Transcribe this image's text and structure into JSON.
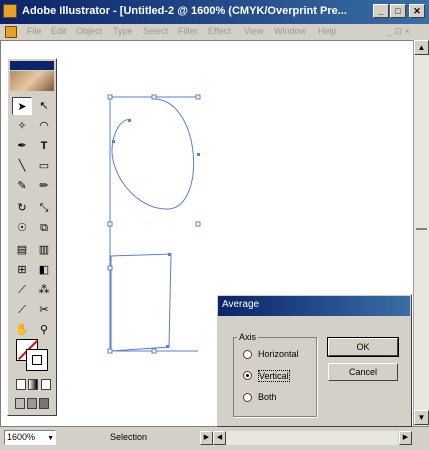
{
  "window": {
    "title": "Adobe Illustrator - [Untitled-2 @ 1600% (CMYK/Overprint Pre...",
    "minimize": "_",
    "maximize": "□",
    "close": "✕"
  },
  "menubar": {
    "items": [
      "File",
      "Edit",
      "Object",
      "Type",
      "Select",
      "Filter",
      "Effect",
      "View",
      "Window",
      "Help"
    ],
    "right": "_ ⊡ ×"
  },
  "statusbar": {
    "zoom": "1600%",
    "status": "Selection"
  },
  "toolbox": {
    "tools": [
      "selection-arrow",
      "direct-selection",
      "magic-wand",
      "lasso",
      "pen",
      "type",
      "line",
      "rectangle",
      "paintbrush",
      "pencil",
      "rotate",
      "scale",
      "warp",
      "free-transform",
      "symbol-sprayer",
      "graph",
      "mesh",
      "gradient",
      "eyedropper",
      "blend",
      "slice",
      "scissors",
      "hand",
      "zoom"
    ],
    "glyphs": {
      "type": "T"
    }
  },
  "dialog": {
    "title": "Average",
    "group_label": "Axis",
    "options": [
      {
        "label": "Horizontal",
        "selected": false
      },
      {
        "label": "Vertical",
        "selected": true
      },
      {
        "label": "Both",
        "selected": false
      }
    ],
    "ok": "OK",
    "cancel": "Cancel"
  },
  "colors": {
    "title_start": "#0a246a",
    "title_end": "#3a6ea5",
    "path_stroke": "#5a7fd8",
    "chrome": "#d4d0c8"
  }
}
